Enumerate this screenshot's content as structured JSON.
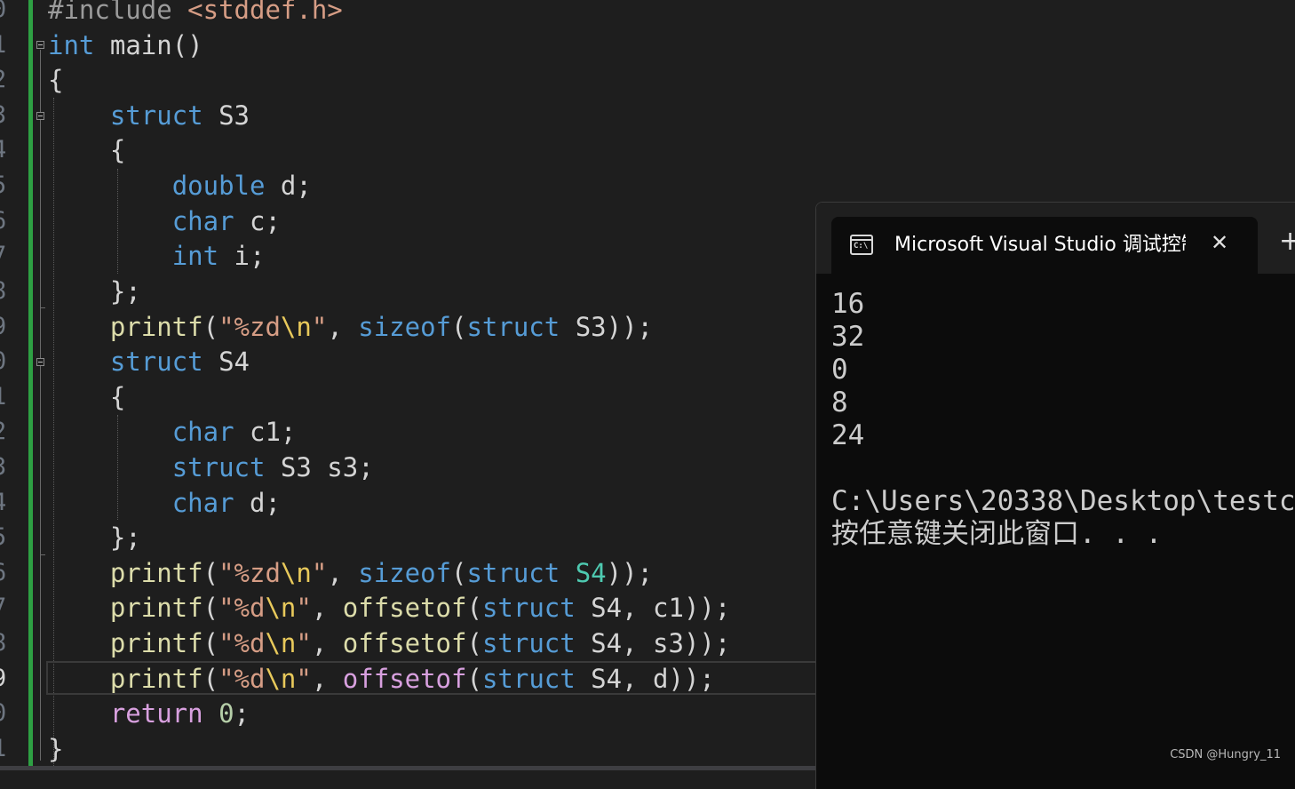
{
  "editor": {
    "line_numbers": [
      "0",
      "1",
      "2",
      "3",
      "4",
      "5",
      "6",
      "7",
      "8",
      "9",
      "0",
      "1",
      "2",
      "3",
      "4",
      "5",
      "6",
      "7",
      "8",
      "9",
      "0",
      "1"
    ],
    "code": {
      "l0": {
        "prep": "#include",
        "inc": "<stddef.h>"
      },
      "l1": {
        "kw": "int",
        "rest": "main()"
      },
      "l2": {
        "rest": "{"
      },
      "l3": {
        "kw": "struct",
        "rest": "S3"
      },
      "l4": {
        "rest": "{"
      },
      "l5": {
        "kw": "double",
        "rest": "d;"
      },
      "l6": {
        "kw": "char",
        "rest": "c;"
      },
      "l7": {
        "kw": "int",
        "rest": "i;"
      },
      "l8": {
        "rest": "};"
      },
      "l9": {
        "fn": "printf",
        "p1": "(",
        "str1": "\"%zd",
        "esc": "\\n",
        "str2": "\"",
        "sep": ", ",
        "kw1": "sizeof",
        "p2": "(",
        "kw2": "struct",
        "name": "S3",
        "end": "));"
      },
      "l10": {
        "kw": "struct",
        "rest": "S4"
      },
      "l11": {
        "rest": "{"
      },
      "l12": {
        "kw": "char",
        "rest": "c1;"
      },
      "l13": {
        "kw": "struct",
        "rest": "S3 s3;"
      },
      "l14": {
        "kw": "char",
        "rest": "d;"
      },
      "l15": {
        "rest": "};"
      },
      "l16": {
        "fn": "printf",
        "p1": "(",
        "str1": "\"%zd",
        "esc": "\\n",
        "str2": "\"",
        "sep": ", ",
        "kw1": "sizeof",
        "p2": "(",
        "kw2": "struct",
        "name": "S4",
        "end": "));"
      },
      "l17": {
        "fn": "printf",
        "p1": "(",
        "str1": "\"%d",
        "esc": "\\n",
        "str2": "\"",
        "sep": ", ",
        "fn2": "offsetof",
        "p2": "(",
        "kw2": "struct",
        "args": "S4, c1",
        "end": "));"
      },
      "l18": {
        "fn": "printf",
        "p1": "(",
        "str1": "\"%d",
        "esc": "\\n",
        "str2": "\"",
        "sep": ", ",
        "fn2": "offsetof",
        "p2": "(",
        "kw2": "struct",
        "args": "S4, s3",
        "end": "));"
      },
      "l19": {
        "fn": "printf",
        "p1": "(",
        "str1": "\"%d",
        "esc": "\\n",
        "str2": "\"",
        "sep": ", ",
        "fn2": "offsetof",
        "p2": "(",
        "kw2": "struct",
        "args": "S4, d",
        "end": "));"
      },
      "l20": {
        "kw": "return",
        "num": "0",
        "rest": ";"
      },
      "l21": {
        "rest": "}"
      }
    }
  },
  "console": {
    "tab_title": "Microsoft Visual Studio 调试控制台",
    "icon_text": "C:\\",
    "close_glyph": "✕",
    "new_tab_glyph": "+",
    "output": [
      "16",
      "32",
      "0",
      "8",
      "24",
      "",
      "C:\\Users\\20338\\Desktop\\testc",
      "按任意键关闭此窗口. . ."
    ]
  },
  "watermark": "CSDN @Hungry_11",
  "colors": {
    "editor_bg": "#1e1e1e",
    "keyword": "#569cd6",
    "function": "#dcdcaa",
    "string": "#d69d85",
    "escape": "#e8c95b",
    "type": "#4ec9b0",
    "number": "#b5cea8",
    "change_bar": "#2ea043",
    "console_bg": "#0c0c0c"
  }
}
